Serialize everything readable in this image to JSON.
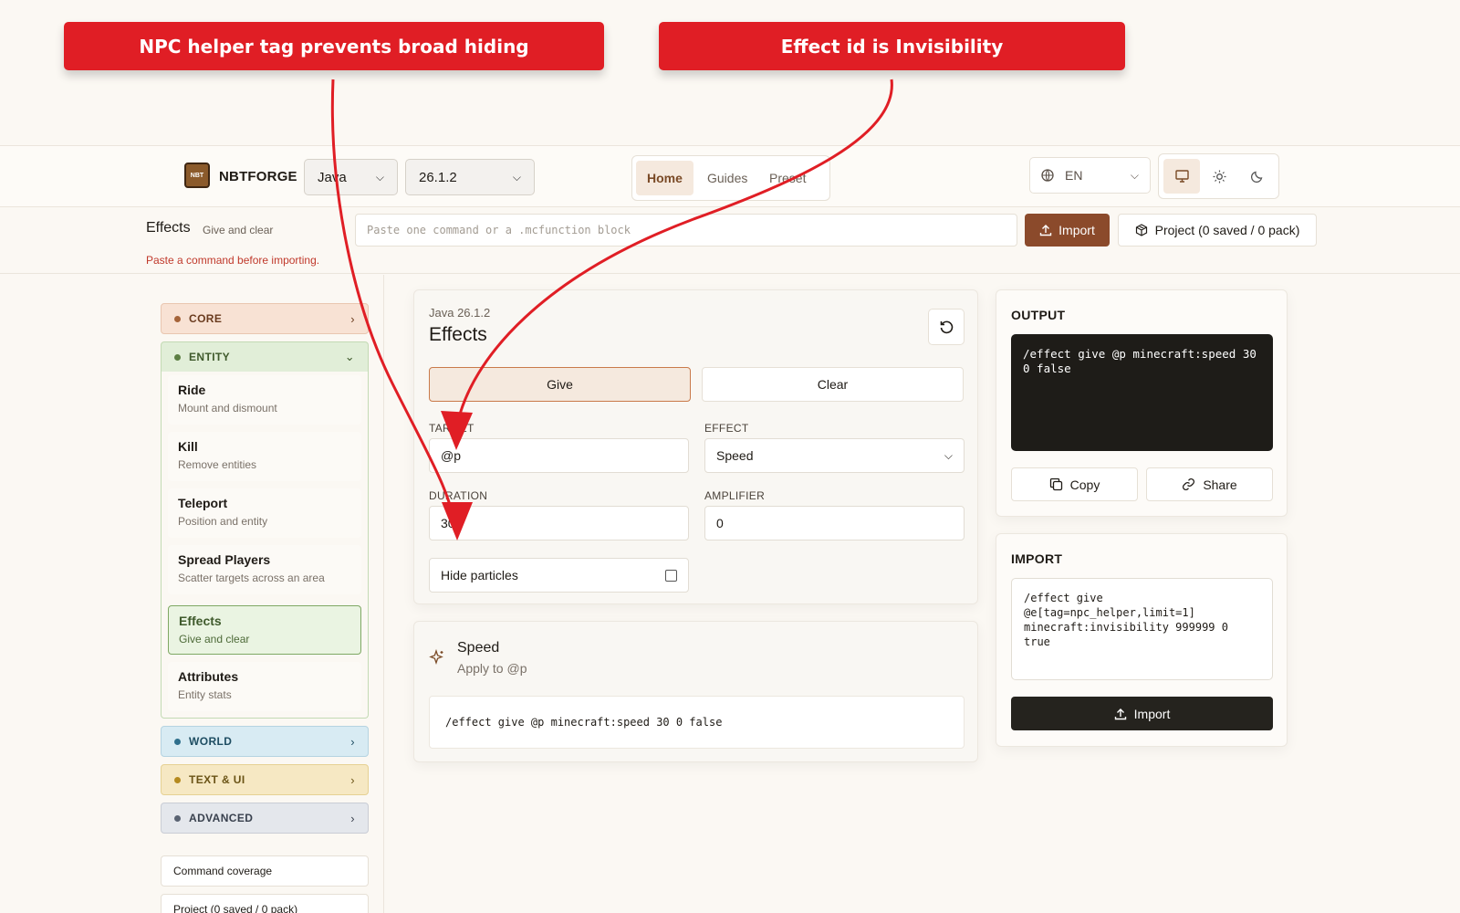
{
  "annotations": {
    "left": "NPC helper tag prevents broad hiding",
    "right": "Effect id is Invisibility"
  },
  "header": {
    "logo_text": "NBT",
    "brand": "NBTFORGE",
    "edition": "Java",
    "version": "26.1.2",
    "nav": [
      "Home",
      "Guides",
      "Preset"
    ],
    "language": "EN"
  },
  "subheader": {
    "title": "Effects",
    "subtitle": "Give and clear",
    "error": "Paste a command before importing.",
    "paste_placeholder": "Paste one command or a .mcfunction block",
    "import_label": "Import",
    "project_label": "Project (0 saved / 0 pack)"
  },
  "sidebar": {
    "categories": {
      "core": "CORE",
      "entity": "ENTITY",
      "world": "WORLD",
      "text_ui": "TEXT & UI",
      "advanced": "ADVANCED"
    },
    "entity_items": [
      {
        "title": "Ride",
        "desc": "Mount and dismount"
      },
      {
        "title": "Kill",
        "desc": "Remove entities"
      },
      {
        "title": "Teleport",
        "desc": "Position and entity"
      },
      {
        "title": "Spread Players",
        "desc": "Scatter targets across an area"
      },
      {
        "title": "Effects",
        "desc": "Give and clear"
      },
      {
        "title": "Attributes",
        "desc": "Entity stats"
      }
    ],
    "links": [
      "Command coverage",
      "Project (0 saved / 0 pack)"
    ]
  },
  "editor": {
    "version_label": "Java 26.1.2",
    "title": "Effects",
    "mode_give": "Give",
    "mode_clear": "Clear",
    "target_label": "TARGET",
    "target_value": "@p",
    "effect_label": "EFFECT",
    "effect_value": "Speed",
    "duration_label": "DURATION",
    "duration_value": "30",
    "amplifier_label": "AMPLIFIER",
    "amplifier_value": "0",
    "hide_particles_label": "Hide particles"
  },
  "summary": {
    "title": "Speed",
    "subtitle": "Apply to @p",
    "command": "/effect give @p minecraft:speed 30 0 false"
  },
  "output": {
    "title": "OUTPUT",
    "command": "/effect give @p minecraft:speed 30 0 false",
    "copy_label": "Copy",
    "share_label": "Share"
  },
  "import_panel": {
    "title": "IMPORT",
    "text": "/effect give @e[tag=npc_helper,limit=1] minecraft:invisibility 999999 0 true",
    "button_label": "Import"
  },
  "colors": {
    "banner": "#e01e25",
    "accent": "#8b4a2b",
    "entity_active": "#7fa864"
  }
}
